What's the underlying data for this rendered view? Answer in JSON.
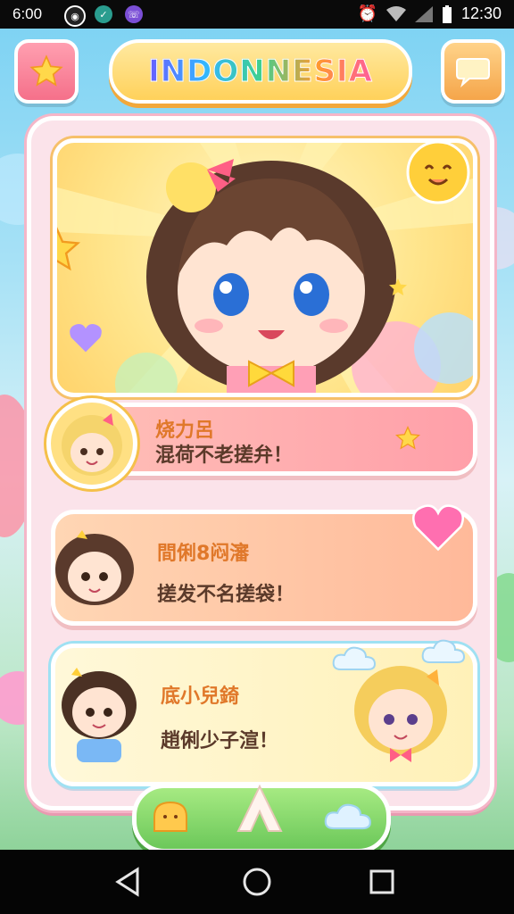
{
  "status_bar": {
    "time_left": "6:00",
    "time_right": "12:30",
    "icons": [
      "messenger-icon",
      "app-icon",
      "viber-icon",
      "alarm-icon",
      "wifi-icon",
      "signal-icon",
      "battery-icon"
    ]
  },
  "header": {
    "title": "INDONNESIA",
    "left_button_icon": "star-icon",
    "right_button_icon": "speech-bubble-icon"
  },
  "hero": {
    "character": "chibi-girl-brown-hair",
    "accent_color": "#ffd36b"
  },
  "cards": [
    {
      "name": "烧力呂",
      "message": "混荷不老搓弁！",
      "accent": "#ffb3a8"
    },
    {
      "name": "間俐8闷瀋",
      "message": "搓发不名搓袋！",
      "accent": "#ffc9a3"
    },
    {
      "name": "底小兒錡",
      "message": "趙俐少子渲！",
      "accent": "#fff5c8"
    }
  ],
  "bottom_bar": {
    "center_icon": "home-arrow-icon",
    "left_icon": "bread-icon",
    "right_icon": "cloud-icon"
  },
  "navbar": {
    "back_icon": "back-icon",
    "home_icon": "home-circle-icon",
    "recents_icon": "recents-icon"
  }
}
